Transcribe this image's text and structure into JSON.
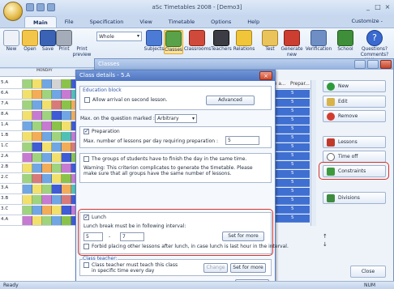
{
  "window": {
    "title": "aSc Timetables 2008 - [Demo3]",
    "customize": "Customize -"
  },
  "tabs": [
    "Main",
    "File",
    "Specification",
    "View",
    "Timetable",
    "Options",
    "Help"
  ],
  "ribbon": {
    "new": "New",
    "open": "Open",
    "save": "Save",
    "print": "Print",
    "print_preview": "Print preview",
    "view_select": "Whole",
    "subjects": "Subjects",
    "classes": "Classes",
    "classrooms": "Classrooms",
    "teachers": "Teachers",
    "relations": "Relations",
    "test": "Test",
    "generate": "Generate new",
    "verification": "Verification",
    "school": "School",
    "questions": "Questions? Comments? Write us"
  },
  "timetable": {
    "day_header": "MONDAY",
    "rows": [
      "5.A",
      "6.A",
      "7.A",
      "8.A",
      "1.A",
      "1.B",
      "1.C",
      "2.A",
      "2.B",
      "2.C",
      "3.A",
      "3.B",
      "3.C",
      "4.A"
    ]
  },
  "classes_window": {
    "title": "Classes",
    "col_allow": "Allow a...",
    "col_prepar": "Prepar...",
    "rows_value": "5",
    "btn_new": "New",
    "btn_edit": "Edit",
    "btn_remove": "Remove",
    "btn_lessons": "Lessons",
    "btn_timeoff": "Time off",
    "btn_constraints": "Constraints",
    "btn_divisions": "Divisions",
    "btn_close": "Close"
  },
  "dialog": {
    "title": "Class details - 5.A",
    "education_block": "Education block",
    "allow_arrival": "Allow arrival on second lesson.",
    "advanced": "Advanced",
    "max_question_label": "Max. on the question marked :",
    "max_question_value": "Arbitrary",
    "preparation": "Preparation",
    "max_prep_label": "Max. number of lessons per day requiring preparation :",
    "max_prep_value": "5",
    "groups_label": "The groups of students have to finish the day in the same time.",
    "warning_text": "Warning: This criterion complicates to generate the timetable. Please make sure that all groups have the same number of lessons.",
    "lunch": "Lunch",
    "lunch_interval": "Lunch break must be in following interval:",
    "lunch_from": "5",
    "lunch_dash": "-",
    "lunch_to": "7",
    "set_for_more": "Set for more",
    "forbid_text": "Forbid placing other lessons after lunch, in case lunch is last hour in the interval.",
    "class_teacher": "Class teacher:",
    "class_teacher_text": "Class teacher must teach this class in specific time every day",
    "change": "Change",
    "set_for_more2": "Set for more",
    "ok": "OK"
  },
  "status": {
    "ready": "Ready",
    "num": "NUM"
  },
  "colors": {
    "accent": "#4f74c1",
    "highlight": "#d4322b"
  }
}
